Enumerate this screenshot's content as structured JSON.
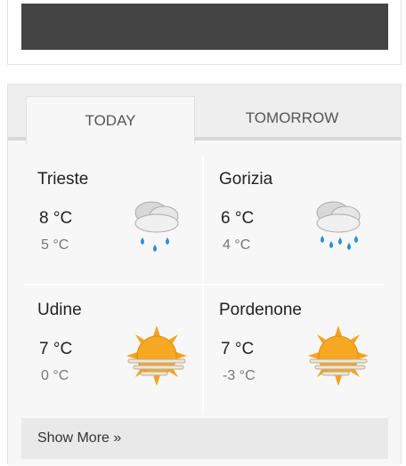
{
  "tabs": {
    "today": "TODAY",
    "tomorrow": "TOMORROW"
  },
  "cities": [
    {
      "name": "Trieste",
      "max": "8 °C",
      "min": "5 °C",
      "icon": "rain-cloud-icon"
    },
    {
      "name": "Gorizia",
      "max": "6 °C",
      "min": "4 °C",
      "icon": "heavy-rain-cloud-icon"
    },
    {
      "name": "Udine",
      "max": "7 °C",
      "min": "0 °C",
      "icon": "sun-fog-icon"
    },
    {
      "name": "Pordenone",
      "max": "7 °C",
      "min": "-3 °C",
      "icon": "sun-fog-icon"
    }
  ],
  "show_more": "Show More »",
  "colors": {
    "accent_sun": "#f5a21e",
    "rain_drop": "#2a8fd6",
    "banner": "#444444"
  }
}
